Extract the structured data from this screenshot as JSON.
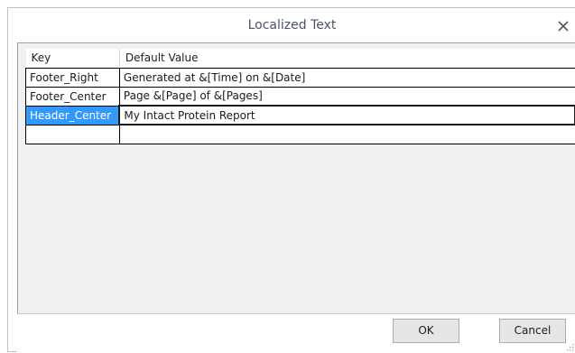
{
  "window": {
    "title": "Localized Text"
  },
  "grid": {
    "columns": [
      "Key",
      "Default Value"
    ],
    "rows": [
      {
        "key": "Footer_Right",
        "value": "Generated at &[Time] on &[Date]"
      },
      {
        "key": "Footer_Center",
        "value": "Page &[Page] of &[Pages]"
      },
      {
        "key": "Header_Center",
        "value": "My Intact Protein Report",
        "selected": true
      },
      {
        "key": "",
        "value": ""
      }
    ]
  },
  "buttons": {
    "ok": "OK",
    "cancel": "Cancel"
  },
  "icons": {
    "close": "close-icon",
    "resize": "resize-grip-icon"
  },
  "colors": {
    "selection": "#3399ff",
    "selection_text": "#ffffff"
  }
}
